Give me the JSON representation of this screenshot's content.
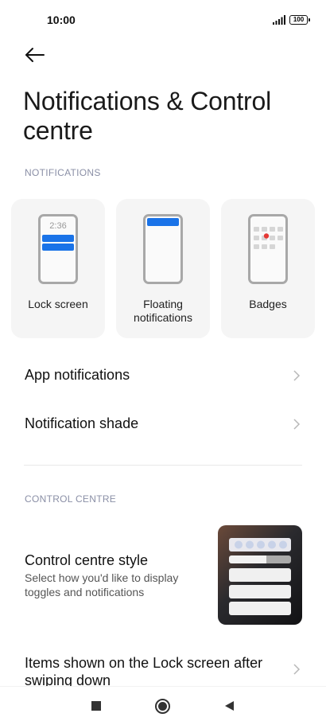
{
  "status_bar": {
    "time": "10:00",
    "battery": "100",
    "icons": [
      "signal-icon",
      "battery-icon"
    ]
  },
  "header": {
    "back_icon": "arrow-left-icon",
    "title": "Notifications & Control centre"
  },
  "notifications": {
    "section_label": "NOTIFICATIONS",
    "cards": [
      {
        "label": "Lock screen",
        "preview_time": "2:36"
      },
      {
        "label": "Floating notifications"
      },
      {
        "label": "Badges"
      }
    ],
    "items": [
      {
        "title": "App notifications"
      },
      {
        "title": "Notification shade"
      }
    ]
  },
  "control_centre": {
    "section_label": "CONTROL CENTRE",
    "style_item": {
      "title": "Control centre style",
      "subtitle": "Select how you'd like to display toggles and notifications"
    },
    "lock_item": {
      "title": "Items shown on the Lock screen after swiping down"
    }
  },
  "nav_bar": {
    "icons": [
      "recents-icon",
      "home-icon",
      "back-icon"
    ]
  },
  "colors": {
    "accent_blue": "#1a73e8",
    "badge_red": "#e53935",
    "section_label": "#8a8fa6",
    "card_bg": "#f5f5f5"
  }
}
